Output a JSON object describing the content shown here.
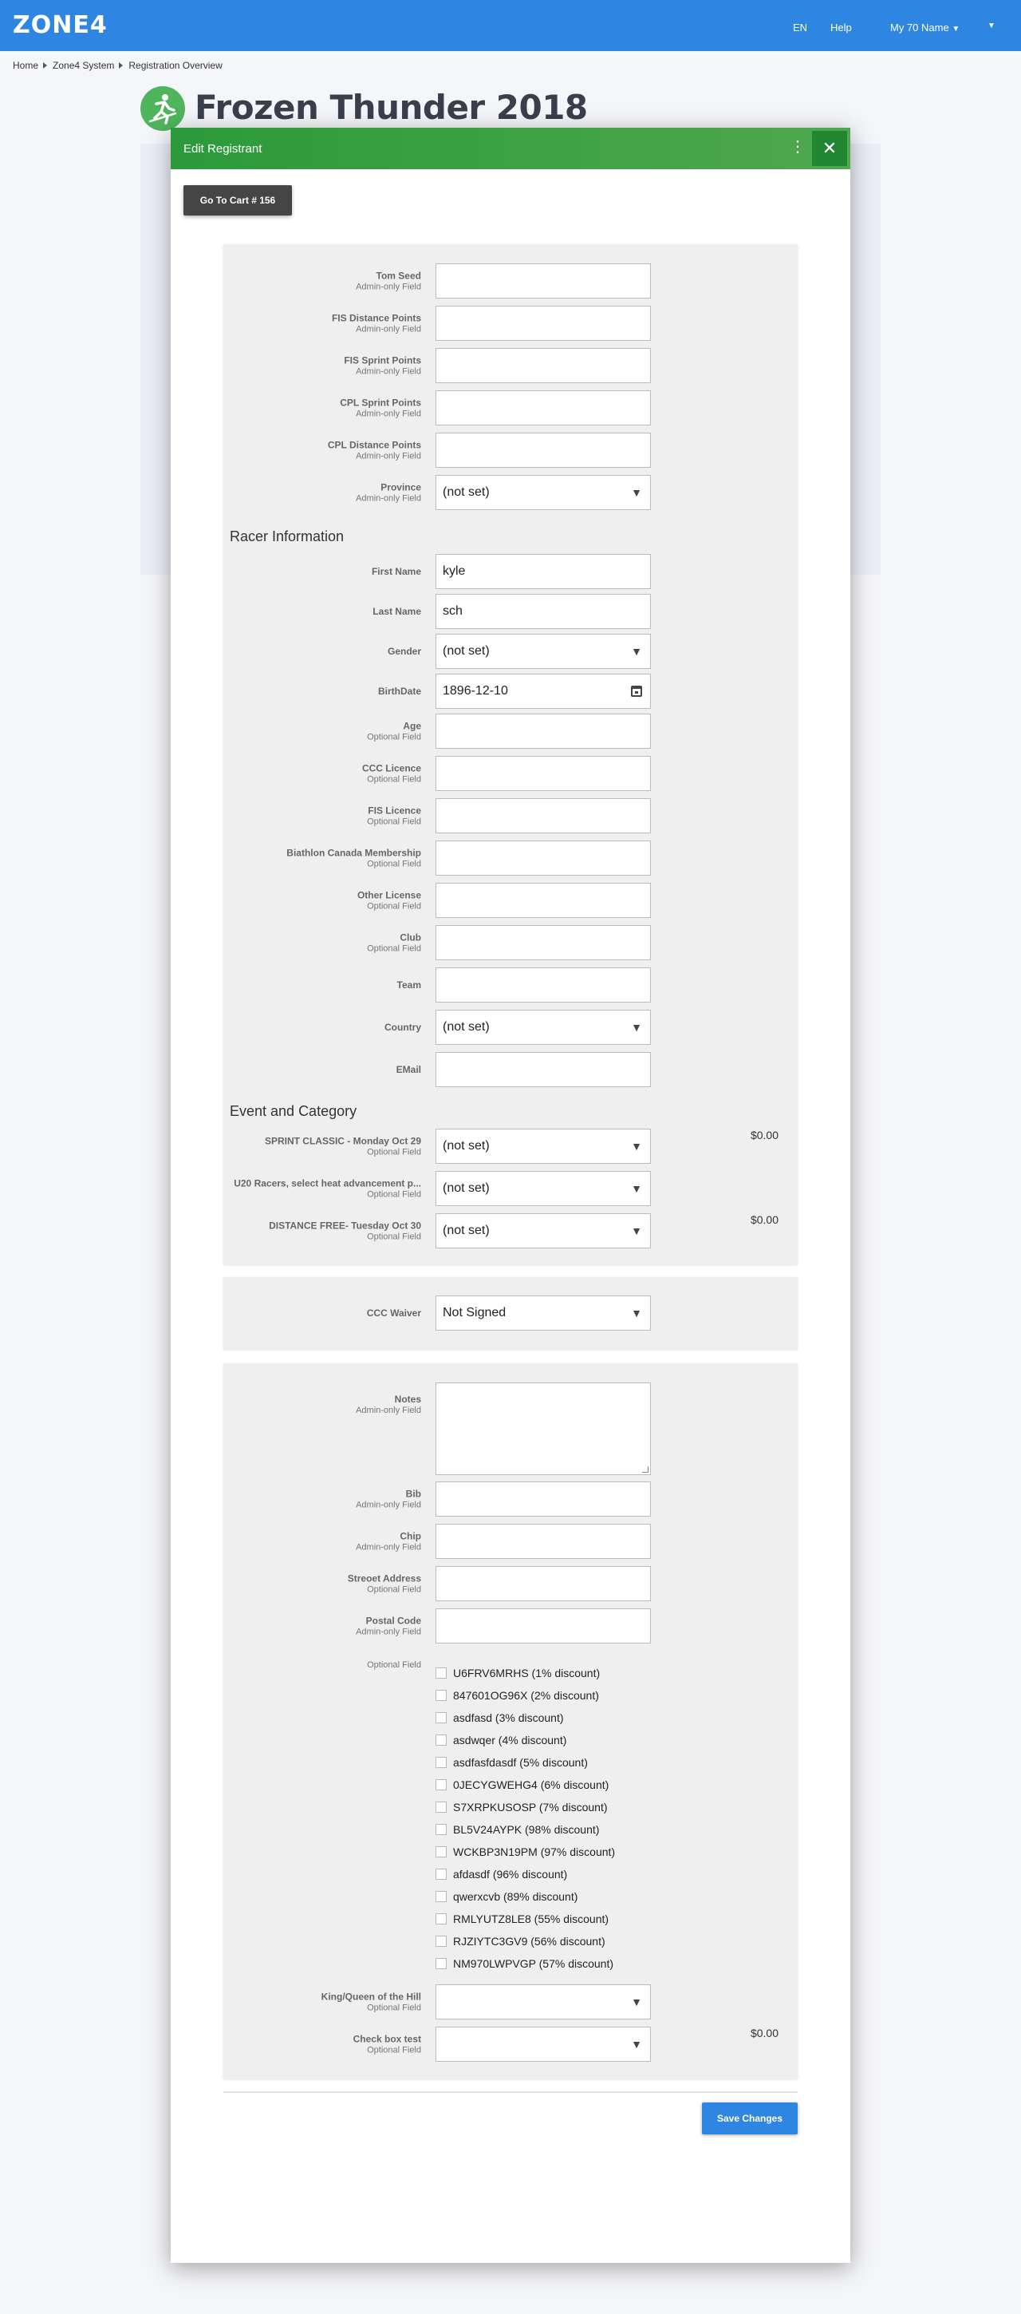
{
  "header": {
    "logo": "ZONE4",
    "lang": "EN",
    "help": "Help",
    "account": "My 70 Name",
    "account_caret": "▼",
    "menu_caret": "▼"
  },
  "breadcrumb": [
    "Home",
    "Zone4 System",
    "Registration Overview"
  ],
  "event": {
    "title": "Frozen Thunder 2018",
    "icon": "skier-icon"
  },
  "dialog": {
    "title": "Edit Registrant",
    "kebab": "⋮",
    "close": "✕",
    "cart_button": "Go To Cart # 156",
    "save_button": "Save Changes"
  },
  "admin_fields": [
    {
      "label": "Tom Seed",
      "sub": "Admin-only Field",
      "value": "",
      "type": "text"
    },
    {
      "label": "FIS Distance Points",
      "sub": "Admin-only Field",
      "value": "",
      "type": "text"
    },
    {
      "label": "FIS Sprint Points",
      "sub": "Admin-only Field",
      "value": "",
      "type": "text"
    },
    {
      "label": "CPL Sprint Points",
      "sub": "Admin-only Field",
      "value": "",
      "type": "text"
    },
    {
      "label": "CPL Distance Points",
      "sub": "Admin-only Field",
      "value": "",
      "type": "text"
    },
    {
      "label": "Province",
      "sub": "Admin-only Field",
      "value": "(not set)",
      "type": "select"
    }
  ],
  "racer_heading": "Racer Information",
  "racer_fields": [
    {
      "label": "First Name",
      "sub": "",
      "value": "kyle",
      "type": "text"
    },
    {
      "label": "Last Name",
      "sub": "",
      "value": "sch",
      "type": "text"
    },
    {
      "label": "Gender",
      "sub": "",
      "value": "(not set)",
      "type": "select"
    },
    {
      "label": "BirthDate",
      "sub": "",
      "value": "1896-12-10",
      "type": "date"
    },
    {
      "label": "Age",
      "sub": "Optional Field",
      "value": "",
      "type": "text"
    },
    {
      "label": "CCC Licence",
      "sub": "Optional Field",
      "value": "",
      "type": "text"
    },
    {
      "label": "FIS Licence",
      "sub": "Optional Field",
      "value": "",
      "type": "text"
    },
    {
      "label": "Biathlon Canada Membership",
      "sub": "Optional Field",
      "value": "",
      "type": "text"
    },
    {
      "label": "Other License",
      "sub": "Optional Field",
      "value": "",
      "type": "text"
    },
    {
      "label": "Club",
      "sub": "Optional Field",
      "value": "",
      "type": "text"
    },
    {
      "label": "Team",
      "sub": "",
      "value": "",
      "type": "text"
    },
    {
      "label": "Country",
      "sub": "",
      "value": "(not set)",
      "type": "select"
    },
    {
      "label": "EMail",
      "sub": "",
      "value": "",
      "type": "text"
    }
  ],
  "event_heading": "Event and Category",
  "event_fields": [
    {
      "label": "SPRINT CLASSIC - Monday Oct 29",
      "sub": "Optional Field",
      "value": "(not set)",
      "type": "select",
      "price": "$0.00"
    },
    {
      "label": "U20 Racers, select heat advancement p...",
      "sub": "Optional Field",
      "value": "(not set)",
      "type": "select",
      "price": ""
    },
    {
      "label": "DISTANCE FREE- Tuesday Oct 30",
      "sub": "Optional Field",
      "value": "(not set)",
      "type": "select",
      "price": "$0.00"
    }
  ],
  "waiver": {
    "label": "CCC Waiver",
    "value": "Not Signed"
  },
  "extra_fields": {
    "notes": {
      "label": "Notes",
      "sub": "Admin-only Field",
      "value": ""
    },
    "inputs": [
      {
        "label": "Bib",
        "sub": "Admin-only Field",
        "value": ""
      },
      {
        "label": "Chip",
        "sub": "Admin-only Field",
        "value": ""
      },
      {
        "label": "Streoet Address",
        "sub": "Optional Field",
        "value": ""
      },
      {
        "label": "Postal Code",
        "sub": "Admin-only Field",
        "value": ""
      }
    ],
    "discount_label": "Optional Field",
    "discounts": [
      "U6FRV6MRHS (1% discount)",
      "847601OG96X (2% discount)",
      "asdfasd (3% discount)",
      "asdwqer (4% discount)",
      "asdfasfdasdf (5% discount)",
      "0JECYGWEHG4 (6% discount)",
      "S7XRPKUSOSP (7% discount)",
      "BL5V24AYPK (98% discount)",
      "WCKBP3N19PM (97% discount)",
      "afdasdf (96% discount)",
      "qwerxcvb (89% discount)",
      "RMLYUTZ8LE8 (55% discount)",
      "RJZIYTC3GV9 (56% discount)",
      "NM970LWPVGP (57% discount)"
    ],
    "selects": [
      {
        "label": "King/Queen of the Hill",
        "sub": "Optional Field",
        "value": "",
        "price": ""
      },
      {
        "label": "Check box test",
        "sub": "Optional Field",
        "value": "",
        "price": "$0.00"
      }
    ]
  },
  "colors": {
    "topbar": "#2f86e2",
    "dialog_header": "#2b9a3b",
    "primary_button": "#2f86e2",
    "cart_button": "#454545"
  }
}
